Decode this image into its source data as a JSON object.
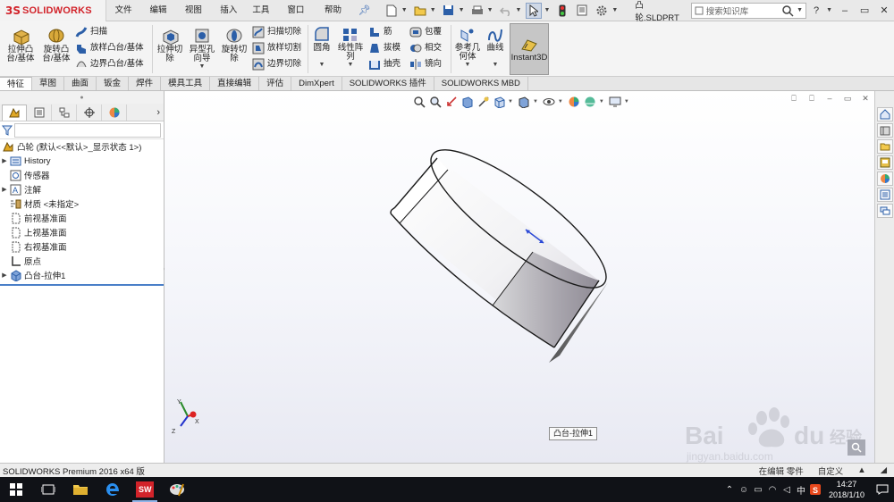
{
  "app": {
    "logo_mark": "3S",
    "logo_text": "SOLIDWORKS",
    "doc_title": "凸轮.SLDPRT"
  },
  "menu": [
    "文件(F)",
    "编辑(E)",
    "视图(V)",
    "插入(I)",
    "工具(T)",
    "窗口(W)",
    "帮助(H)"
  ],
  "search": {
    "placeholder": "搜索知识库"
  },
  "ribbon": {
    "extrude_boss": "拉伸凸\n台/基体",
    "revolve_boss": "旋转凸\n台/基体",
    "sweep": "扫描",
    "loft_boss": "放样凸台/基体",
    "boundary_boss": "边界凸台/基体",
    "extrude_cut": "拉伸切\n除",
    "hole_wizard": "异型孔\n向导",
    "revolve_cut": "旋转切\n除",
    "swept_cut": "扫描切除",
    "lofted_cut": "放样切割",
    "boundary_cut": "边界切除",
    "fillet": "圆角",
    "linear_pattern": "线性阵\n列",
    "rib": "筋",
    "draft": "拔模",
    "shell": "抽壳",
    "wrap": "包覆",
    "intersect": "相交",
    "mirror": "镜向",
    "reference_geometry": "参考几\n何体",
    "curves": "曲线",
    "instant3d": "Instant3D"
  },
  "tabs": [
    "特征",
    "草图",
    "曲面",
    "钣金",
    "焊件",
    "模具工具",
    "直接编辑",
    "评估",
    "DimXpert",
    "SOLIDWORKS 插件",
    "SOLIDWORKS MBD"
  ],
  "tree": {
    "root": "凸轮 (默认<<默认>_显示状态 1>)",
    "items": [
      "History",
      "传感器",
      "注解",
      "材质 <未指定>",
      "前视基准面",
      "上视基准面",
      "右视基准面",
      "原点",
      "凸台-拉伸1"
    ]
  },
  "tooltip": "凸台-拉伸1",
  "status": {
    "left": "SOLIDWORKS Premium 2016 x64 版",
    "editing": "在编辑 零件",
    "custom": "自定义"
  },
  "taskbar": {
    "tray_ime": "中",
    "time": "14:27",
    "date": "2018/1/10"
  },
  "watermark": {
    "brand": "Bai",
    "brand2": "du",
    "jingyan": "经验",
    "url": "jingyan.baidu.com"
  },
  "colors": {
    "accent": "#d2232a",
    "selection": "#4a7fc8",
    "taskbar": "#101217"
  }
}
